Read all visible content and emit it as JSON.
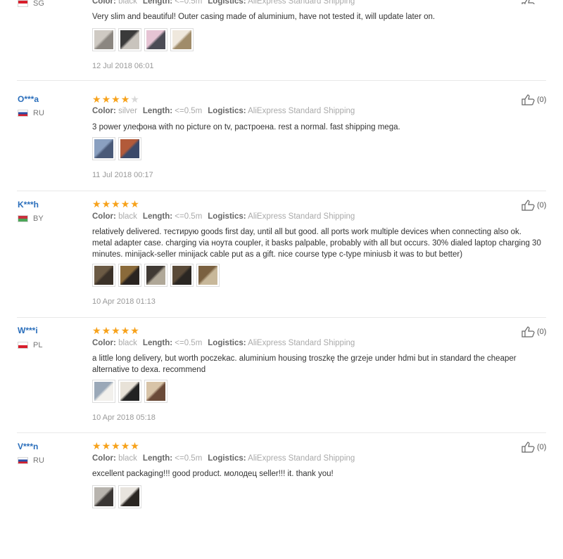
{
  "labels": {
    "color": "Color:",
    "length": "Length:",
    "logistics": "Logistics:"
  },
  "reviews": [
    {
      "user": "",
      "country": "SG",
      "flag": [
        "#d81e2b",
        "#ffffff"
      ],
      "rating": null,
      "color": "black",
      "length": "<=0.5m",
      "logistics": "AliExpress Standard Shipping",
      "text": "Very slim and beautiful! Outer casing made of aluminium, have not tested it, will update later on.",
      "photos": [
        [
          "#cfcac3",
          "#8b8680"
        ],
        [
          "#3a3a3a",
          "#c9c4bd"
        ],
        [
          "#e6c4d4",
          "#4b4b55"
        ],
        [
          "#efe8dd",
          "#a08c6a"
        ]
      ],
      "date": "12 Jul 2018 06:01",
      "helpful": ""
    },
    {
      "user": "O***a",
      "country": "RU",
      "flag": [
        "#ffffff",
        "#2b4fa6",
        "#d81e2b"
      ],
      "rating": 4,
      "color": "silver",
      "length": "<=0.5m",
      "logistics": "AliExpress Standard Shipping",
      "text": "3 power улефона with no picture on tv, растроена. rest a normal. fast shipping mega.",
      "photos": [
        [
          "#8aa0c0",
          "#4a5a78"
        ],
        [
          "#b25a3a",
          "#3c4a6a"
        ]
      ],
      "date": "11 Jul 2018 00:17",
      "helpful": "(0)"
    },
    {
      "user": "K***h",
      "country": "BY",
      "flag": [
        "#c8313e",
        "#4aa657"
      ],
      "rating": 5,
      "color": "black",
      "length": "<=0.5m",
      "logistics": "AliExpress Standard Shipping",
      "text": "relatively delivered. тестирую goods first day, until all but good. all ports work multiple devices when connecting also ok. metal adapter case. charging via ноута coupler, it basks palpable, probably with all but occurs. 30% dialed laptop charging 30 minutes. minijack-seller minijack cable put as a gift. nice course type c-type miniusb it was to but better)",
      "photos": [
        [
          "#6b5a44",
          "#3a3128"
        ],
        [
          "#8a6a3a",
          "#2a2420"
        ],
        [
          "#403a34",
          "#b0a898"
        ],
        [
          "#5a4a38",
          "#2a2622"
        ],
        [
          "#7a6040",
          "#c8b89a"
        ]
      ],
      "date": "10 Apr 2018 01:13",
      "helpful": "(0)"
    },
    {
      "user": "W***i",
      "country": "PL",
      "flag": [
        "#ffffff",
        "#d81e2b"
      ],
      "rating": 5,
      "color": "black",
      "length": "<=0.5m",
      "logistics": "AliExpress Standard Shipping",
      "text": "a little long delivery, but worth poczekac. aluminium housing troszkę the grzeje under hdmi but in standard the cheaper alternative to dexa. recommend",
      "photos": [
        [
          "#9aa8b8",
          "#f2f0ec"
        ],
        [
          "#e8e2d8",
          "#222222"
        ],
        [
          "#d8c4a8",
          "#6a4a38"
        ]
      ],
      "date": "10 Apr 2018 05:18",
      "helpful": "(0)"
    },
    {
      "user": "V***n",
      "country": "RU",
      "flag": [
        "#ffffff",
        "#2b4fa6",
        "#d81e2b"
      ],
      "rating": 5,
      "color": "black",
      "length": "<=0.5m",
      "logistics": "AliExpress Standard Shipping",
      "text": "excellent packaging!!! good product. молодец seller!!! it. thank you!",
      "photos": [
        [
          "#b8b4ae",
          "#3a3634"
        ],
        [
          "#e8e4de",
          "#2a2622"
        ]
      ],
      "date": "",
      "helpful": "(0)"
    }
  ]
}
